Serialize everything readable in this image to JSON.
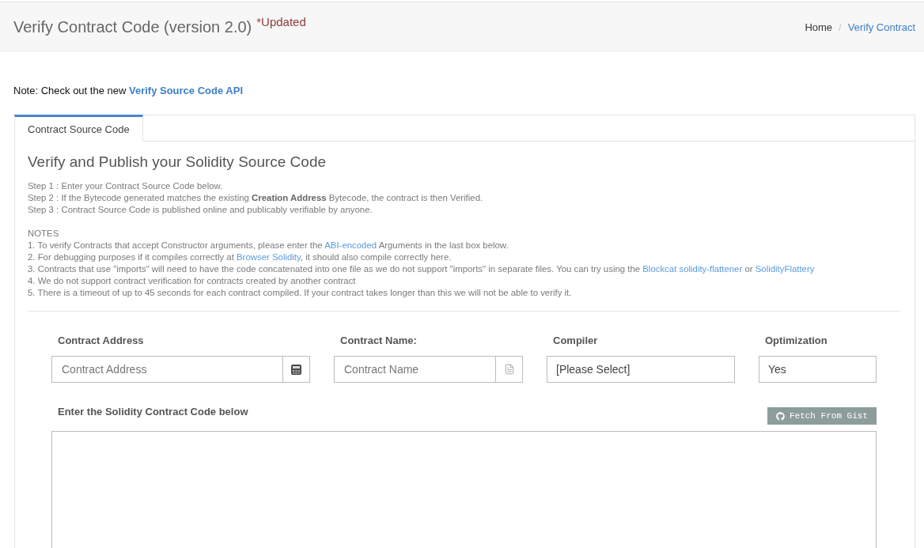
{
  "header": {
    "title": "Verify Contract Code (version 2.0)",
    "badge": "*Updated",
    "breadcrumb": {
      "separator": "/",
      "items": [
        {
          "label": "Home",
          "selected": false
        },
        {
          "label": "Verify Contract",
          "selected": true
        }
      ]
    }
  },
  "note": {
    "text": "Note: Check out the new ",
    "link": "Verify Source Code API"
  },
  "tabs": [
    {
      "label": "Contract Source Code",
      "selected": true
    }
  ],
  "panel": {
    "heading": "Verify and Publish your Solidity Source Code",
    "steps": [
      "Step 1 : Enter your Contract Source Code below.",
      "Step 2 : If the Bytecode generated matches the existing **Creation Address** Bytecode, the contract is then Verified.",
      "Step 3 : Contract Source Code is published online and publicably verifiable by anyone."
    ],
    "notes_title": "NOTES",
    "notes": [
      {
        "parts": [
          {
            "kind": "text",
            "text": "1. To verify Contracts that accept Constructor arguments, please enter the "
          },
          {
            "kind": "link",
            "text": "ABI-encoded"
          },
          {
            "kind": "text",
            "text": " Arguments in the last box below."
          }
        ]
      },
      {
        "parts": [
          {
            "kind": "text",
            "text": "2. For debugging purposes if it compiles correctly at "
          },
          {
            "kind": "link",
            "text": "Browser Solidity"
          },
          {
            "kind": "text",
            "text": ", it should also compile correctly here."
          }
        ]
      },
      {
        "parts": [
          {
            "kind": "text",
            "text": "3. Contracts that use \"imports\" will need to have the code concatenated into one file as we do not support \"imports\" in separate files. You can try using the "
          },
          {
            "kind": "link",
            "text": "Blockcat solidity-flattener"
          },
          {
            "kind": "text",
            "text": " or "
          },
          {
            "kind": "link",
            "text": "SolidityFlattery"
          }
        ]
      },
      {
        "parts": [
          {
            "kind": "text",
            "text": "4. We do not support contract verification for contracts created by another contract"
          }
        ]
      },
      {
        "parts": [
          {
            "kind": "text",
            "text": "5. There is a timeout of up to 45 seconds for each contract compiled. If your contract takes longer than this we will not be able to verify it."
          }
        ]
      }
    ]
  },
  "form": {
    "fields": [
      {
        "kind": "address",
        "label": "Contract Address",
        "placeholder": "Contract Address"
      },
      {
        "kind": "name",
        "label": "Contract Name:",
        "placeholder": "Contract Name"
      },
      {
        "kind": "select",
        "label": "Compiler",
        "value": "[Please Select]"
      },
      {
        "kind": "select",
        "label": "Optimization",
        "value": "Yes"
      }
    ]
  },
  "code": {
    "label": "Enter the Solidity Contract Code below",
    "button": "Fetch From Gist"
  }
}
